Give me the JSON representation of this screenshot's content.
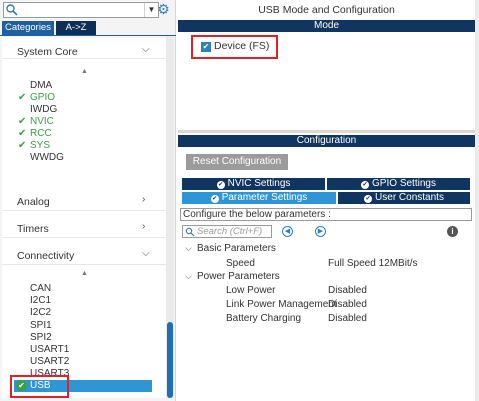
{
  "left": {
    "tabs": [
      "Categories",
      "A->Z"
    ],
    "categories": [
      {
        "name": "System Core",
        "expanded": true,
        "items": [
          {
            "label": "DMA",
            "enabled": false
          },
          {
            "label": "GPIO",
            "enabled": true
          },
          {
            "label": "IWDG",
            "enabled": false
          },
          {
            "label": "NVIC",
            "enabled": true
          },
          {
            "label": "RCC",
            "enabled": true
          },
          {
            "label": "SYS",
            "enabled": true
          },
          {
            "label": "WWDG",
            "enabled": false
          }
        ]
      },
      {
        "name": "Analog",
        "expanded": false
      },
      {
        "name": "Timers",
        "expanded": false
      },
      {
        "name": "Connectivity",
        "expanded": true,
        "items": [
          {
            "label": "CAN"
          },
          {
            "label": "I2C1"
          },
          {
            "label": "I2C2"
          },
          {
            "label": "SPI1"
          },
          {
            "label": "SPI2"
          },
          {
            "label": "USART1"
          },
          {
            "label": "USART2"
          },
          {
            "label": "USART3"
          },
          {
            "label": "USB",
            "selected": true
          }
        ]
      }
    ]
  },
  "right": {
    "title": "USB Mode and Configuration",
    "mode_header": "Mode",
    "device_label": "Device (FS)",
    "config_header": "Configuration",
    "reset_button": "Reset Configuration",
    "tabs": [
      "NVIC Settings",
      "GPIO Settings",
      "Parameter Settings",
      "User Constants"
    ],
    "configure_text": "Configure the below parameters :",
    "search_placeholder": "Search (Ctrl+F)",
    "groups": [
      {
        "name": "Basic Parameters",
        "params": [
          {
            "name": "Speed",
            "value": "Full Speed 12MBit/s"
          }
        ]
      },
      {
        "name": "Power Parameters",
        "params": [
          {
            "name": "Low Power",
            "value": "Disabled"
          },
          {
            "name": "Link Power Management",
            "value": "Disabled"
          },
          {
            "name": "Battery Charging",
            "value": "Disabled"
          }
        ]
      }
    ]
  },
  "colors": {
    "accent_blue": "#2f96d6",
    "dark_navy": "#0f3560",
    "enabled_green": "#3aa14a",
    "highlight_red": "#e12127"
  }
}
